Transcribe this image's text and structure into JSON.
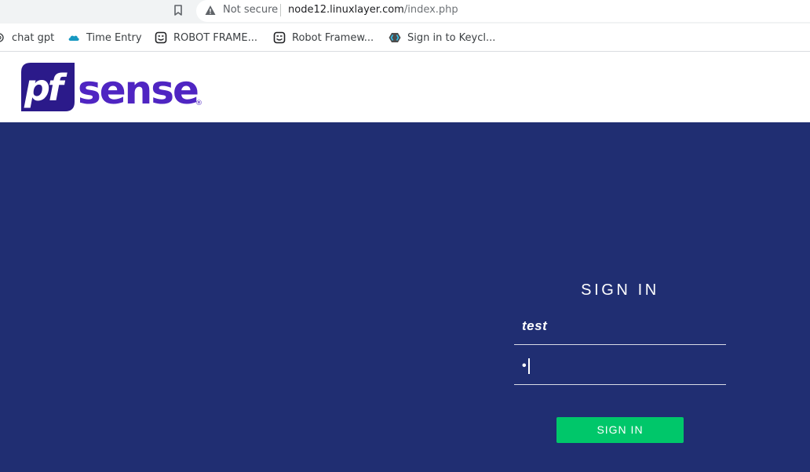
{
  "browser": {
    "security_label": "Not secure",
    "url_host": "node12.linuxlayer.com",
    "url_path": "/index.php",
    "icons": {
      "bookmark": "bookmark-icon",
      "security": "warning-icon"
    }
  },
  "bookmarks": [
    {
      "label": "chat gpt",
      "icon": "openai-icon"
    },
    {
      "label": "Time Entry",
      "icon": "cloud-icon"
    },
    {
      "label": "ROBOT FRAME...",
      "icon": "robot-icon"
    },
    {
      "label": "Robot Framew...",
      "icon": "robot-icon"
    },
    {
      "label": "Sign in to Keycl...",
      "icon": "keycloak-icon"
    }
  ],
  "header": {
    "logo_text": "pfsense",
    "logo_mark": "®"
  },
  "login": {
    "title": "SIGN IN",
    "username_value": "test",
    "password_value": "•",
    "button_label": "SIGN IN"
  },
  "colors": {
    "background": "#202e72",
    "button": "#00c76a",
    "logo_dark": "#2b1a8a",
    "logo_light": "#5228c8"
  }
}
